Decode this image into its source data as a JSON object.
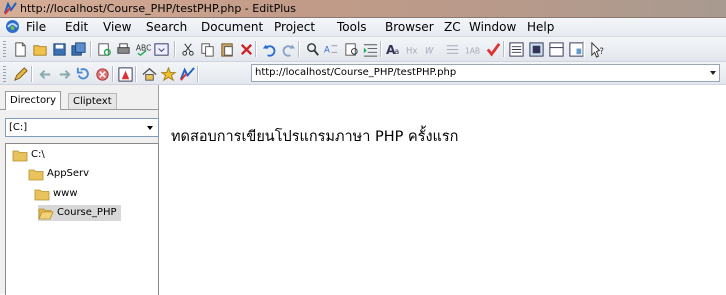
{
  "window": {
    "title": "http://localhost/Course_PHP/testPHP.php - EditPlus"
  },
  "menu": {
    "items": [
      "File",
      "Edit",
      "View",
      "Search",
      "Document",
      "Project",
      "Tools",
      "Browser",
      "ZC",
      "Window",
      "Help"
    ]
  },
  "toolbar": {
    "tools": [
      "new-file-icon",
      "open-folder-icon",
      "save-icon",
      "save-all-icon",
      "print-preview-icon",
      "print-icon",
      "spell-check-icon",
      "browser-preview-icon",
      "cut-icon",
      "copy-icon",
      "paste-icon",
      "delete-icon",
      "undo-icon",
      "redo-icon",
      "find-icon",
      "replace-icon",
      "find-in-files-icon",
      "indent-icon",
      "font-icon",
      "hex-icon",
      "wrap-icon",
      "line-numbers-icon",
      "column-icon",
      "check-icon",
      "view1-icon",
      "view2-icon",
      "view3-icon",
      "view4-icon",
      "help-icon"
    ]
  },
  "browser_bar": {
    "tools": [
      "edit-pen-icon",
      "back-icon",
      "forward-icon",
      "refresh-icon",
      "stop-icon",
      "browser-icon",
      "home-icon",
      "favorites-icon",
      "go-icon"
    ],
    "address": "http://localhost/Course_PHP/testPHP.php"
  },
  "left_panel": {
    "tabs": [
      "Directory",
      "Cliptext"
    ],
    "active_tab": "Directory",
    "drive": "[C:]",
    "tree": [
      {
        "label": "C:\\",
        "level": 0
      },
      {
        "label": "AppServ",
        "level": 1
      },
      {
        "label": "www",
        "level": 2
      },
      {
        "label": "Course_PHP",
        "level": 3,
        "selected": true
      }
    ]
  },
  "editor": {
    "content": "ทดสอบการเขียนโปรแกรมภาษา PHP ครั้งแรก"
  },
  "colors": {
    "titlebar": "#c9a592",
    "selected_bg": "#d8d8d8",
    "folder": "#e8c25a"
  }
}
